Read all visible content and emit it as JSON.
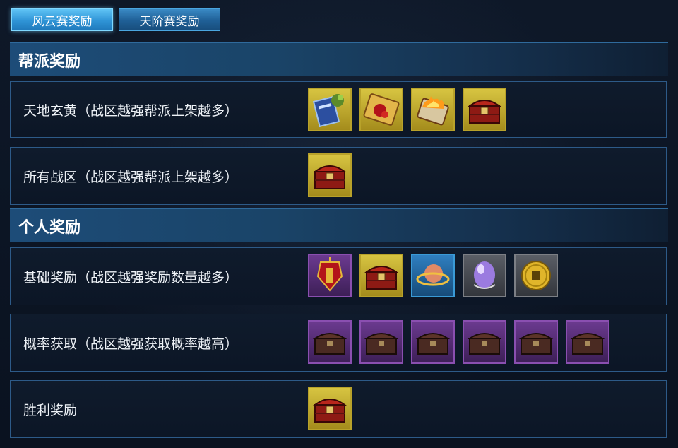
{
  "tabs": [
    {
      "label": "风云赛奖励",
      "active": true
    },
    {
      "label": "天阶赛奖励",
      "active": false
    }
  ],
  "sections": {
    "guild": {
      "title": "帮派奖励",
      "rows": [
        {
          "label": "天地玄黄（战区越强帮派上架越多）",
          "items": [
            "book-icon",
            "scroll-icon",
            "flame-scroll-icon",
            "treasure-chest-icon"
          ]
        },
        {
          "label": "所有战区（战区越强帮派上架越多）",
          "items": [
            "treasure-chest-icon"
          ]
        }
      ]
    },
    "personal": {
      "title": "个人奖励",
      "rows": [
        {
          "label": "基础奖励（战区越强奖励数量越多）",
          "items": [
            "token-pendant-icon",
            "treasure-chest-icon",
            "orb-ring-icon",
            "crystal-egg-icon",
            "gold-coin-icon"
          ]
        },
        {
          "label": "概率获取（战区越强获取概率越高）",
          "items": [
            "dark-chest-icon",
            "dark-chest-icon",
            "dark-chest-icon",
            "dark-chest-icon",
            "dark-chest-icon",
            "dark-chest-icon"
          ]
        },
        {
          "label": "胜利奖励",
          "items": [
            "treasure-chest-icon"
          ]
        }
      ]
    }
  },
  "colors": {
    "gold_frame": "#b8a22a",
    "purple_frame": "#8a4fb0",
    "blue_frame": "#3a9ad6",
    "grey_frame": "#7c7f85",
    "row_border": "#2d5a88",
    "header_blue": "#1d4c78"
  }
}
